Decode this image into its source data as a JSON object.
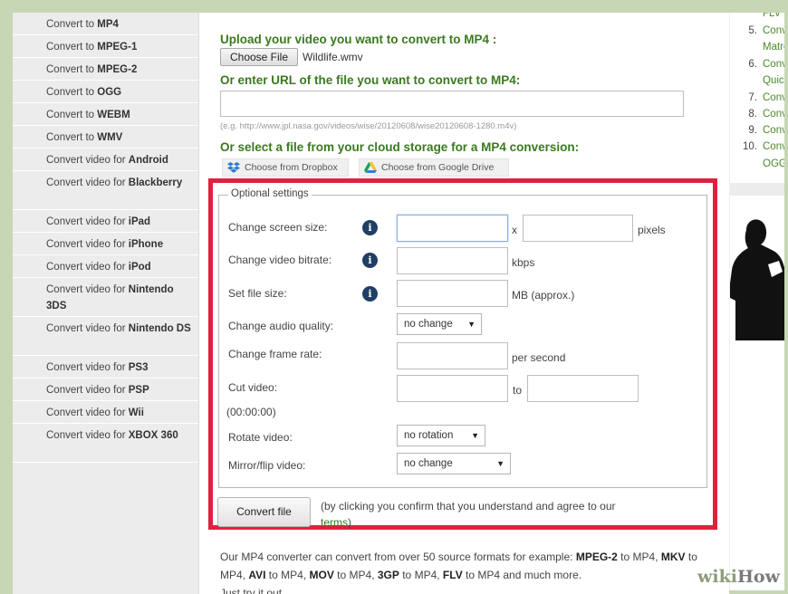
{
  "sidebar": {
    "items": [
      {
        "prefix": "Convert to ",
        "bold": "MP4"
      },
      {
        "prefix": "Convert to ",
        "bold": "MPEG-1"
      },
      {
        "prefix": "Convert to ",
        "bold": "MPEG-2"
      },
      {
        "prefix": "Convert to ",
        "bold": "OGG"
      },
      {
        "prefix": "Convert to ",
        "bold": "WEBM"
      },
      {
        "prefix": "Convert to ",
        "bold": "WMV"
      },
      {
        "prefix": "Convert video for ",
        "bold": "Android"
      },
      {
        "prefix": "Convert video for ",
        "bold": "Blackberry"
      },
      {
        "prefix": "Convert video for ",
        "bold": "iPad"
      },
      {
        "prefix": "Convert video for ",
        "bold": "iPhone"
      },
      {
        "prefix": "Convert video for ",
        "bold": "iPod"
      },
      {
        "prefix": "Convert video for ",
        "bold": "Nintendo 3DS"
      },
      {
        "prefix": "Convert video for ",
        "bold": "Nintendo DS"
      },
      {
        "prefix": "Convert video for ",
        "bold": "PS3"
      },
      {
        "prefix": "Convert video for ",
        "bold": "PSP"
      },
      {
        "prefix": "Convert video for ",
        "bold": "Wii"
      },
      {
        "prefix": "Convert video for ",
        "bold": "XBOX 360"
      }
    ]
  },
  "upload": {
    "heading": "Upload your video you want to convert to MP4 :",
    "choose_file_label": "Choose File",
    "file_name": "Wildlife.wmv"
  },
  "url": {
    "heading": "Or enter URL of the file you want to convert to MP4:",
    "value": "",
    "hint": "(e.g. http://www.jpl.nasa.gov/videos/wise/20120608/wise20120608-1280.m4v)"
  },
  "cloud": {
    "heading": "Or select a file from your cloud storage for a MP4 conversion:",
    "dropbox_label": "Choose from Dropbox",
    "gdrive_label": "Choose from Google Drive"
  },
  "settings": {
    "legend": "Optional settings",
    "screen_size_label": "Change screen size:",
    "screen_size_x": "x",
    "screen_size_unit": "pixels",
    "bitrate_label": "Change video bitrate:",
    "bitrate_unit": "kbps",
    "file_size_label": "Set file size:",
    "file_size_unit": "MB (approx.)",
    "audio_label": "Change audio quality:",
    "audio_value": "no change",
    "frame_rate_label": "Change frame rate:",
    "frame_rate_unit": "per second",
    "cut_label": "Cut video:",
    "cut_format": "(00:00:00)",
    "cut_to": "to",
    "rotate_label": "Rotate video:",
    "rotate_value": "no rotation",
    "mirror_label": "Mirror/flip video:",
    "mirror_value": "no change",
    "info_glyph": "i"
  },
  "convert": {
    "button_label": "Convert file",
    "agree_text": "(by clicking you confirm that you understand and agree to our ",
    "terms_link": "terms",
    "agree_close": ")"
  },
  "description": {
    "intro": "Our MP4 converter can convert from over 50 source formats for example: ",
    "f1": "MPEG-2",
    "t1": " to MP4, ",
    "f2": "MKV",
    "t2": " to MP4, ",
    "f3": "AVI",
    "t3": " to MP4, ",
    "f4": "MOV",
    "t4": " to MP4, ",
    "f5": "3GP",
    "t5": " to MP4, ",
    "f6": "FLV",
    "t6": " to MP4 and much more.",
    "line3": "Just try it out."
  },
  "right_list": [
    {
      "num": "",
      "text": "FLV"
    },
    {
      "num": "5.",
      "text": "Conv"
    },
    {
      "num": "",
      "text": "Matro"
    },
    {
      "num": "6.",
      "text": "Conv"
    },
    {
      "num": "",
      "text": "Quick"
    },
    {
      "num": "7.",
      "text": "Conv"
    },
    {
      "num": "8.",
      "text": "Conv"
    },
    {
      "num": "9.",
      "text": "Conv"
    },
    {
      "num": "10.",
      "text": "Conv"
    },
    {
      "num": "",
      "text": "OGG"
    }
  ],
  "watermark": {
    "wiki": "wiki",
    "how": "How"
  },
  "colors": {
    "accent_green": "#3a7a1f",
    "highlight_red": "#e0213e",
    "info_icon": "#1f3f63",
    "frame_green": "#c7d7b5"
  }
}
